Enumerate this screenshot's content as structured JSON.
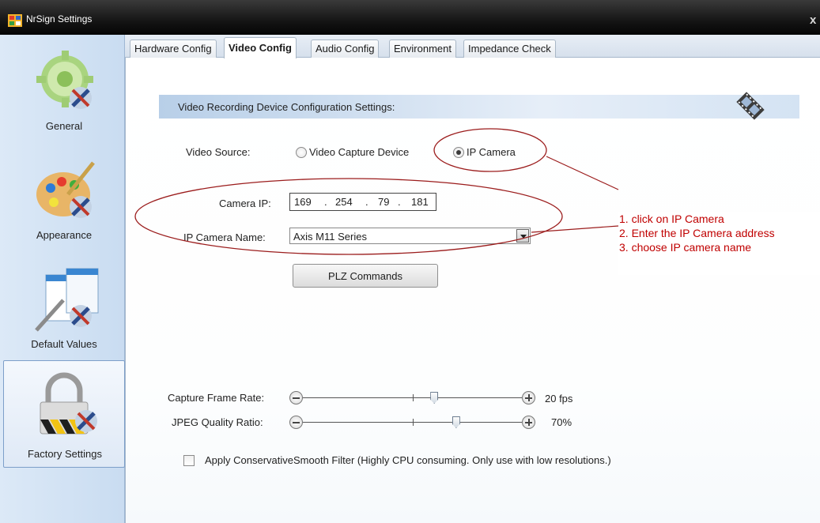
{
  "window": {
    "title": "NrSign Settings",
    "close_glyph": "x",
    "icon": "app-grid-icon"
  },
  "sidebar": {
    "items": [
      {
        "label": "General",
        "icon": "gear-wrench-icon",
        "selected": false
      },
      {
        "label": "Appearance",
        "icon": "palette-wrench-icon",
        "selected": false
      },
      {
        "label": "Default Values",
        "icon": "documents-pen-icon",
        "selected": false
      },
      {
        "label": "Factory Settings",
        "icon": "padlock-icon",
        "selected": true
      }
    ]
  },
  "tabs": [
    {
      "label": "Hardware Config",
      "active": false
    },
    {
      "label": "Video Config",
      "active": true
    },
    {
      "label": "Audio Config",
      "active": false
    },
    {
      "label": "Environment",
      "active": false
    },
    {
      "label": "Impedance Check",
      "active": false
    }
  ],
  "video": {
    "section_title": "Video Recording Device Configuration Settings:",
    "source_label": "Video Source:",
    "source_options": [
      "Video Capture Device",
      "IP Camera"
    ],
    "source_selected": "IP Camera",
    "camera_ip_label": "Camera IP:",
    "camera_ip": [
      "169",
      "254",
      "79",
      "181"
    ],
    "camera_ip_sep": ".",
    "camera_name_label": "IP Camera Name:",
    "camera_name": "Axis M11 Series",
    "ptz_button": "PLZ Commands",
    "frame_rate_label": "Capture Frame Rate:",
    "frame_rate_value": "20 fps",
    "frame_rate_position": 0.6,
    "jpeg_label": "JPEG Quality Ratio:",
    "jpeg_value": "70%",
    "jpeg_position": 0.7,
    "filter_label": "Apply ConservativeSmooth Filter (Highly CPU consuming. Only use with low resolutions.)",
    "filter_checked": false
  },
  "annotation": {
    "lines": [
      "1. click on IP Camera",
      "2. Enter the IP Camera address",
      "3. choose IP camera name"
    ],
    "color": "#c00000"
  }
}
